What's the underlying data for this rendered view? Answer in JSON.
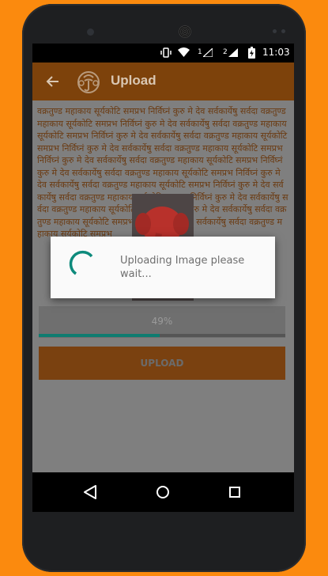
{
  "status_bar": {
    "sim1": "1",
    "sim2": "2",
    "time": "11:03"
  },
  "app_bar": {
    "title": "Upload"
  },
  "content": {
    "mantra_text": "वक्रतुण्ड महाकाय सूर्यकोटि समप्रभ निर्विघ्नं कुरु मे देव सर्वकार्येषु सर्वदा वक्रतुण्ड महाकाय सूर्यकोटि समप्रभ निर्विघ्नं कुरु मे देव सर्वकार्येषु सर्वदा वक्रतुण्ड महाकाय सूर्यकोटि समप्रभ निर्विघ्नं कुरु मे देव सर्वकार्येषु सर्वदा वक्रतुण्ड महाकाय सूर्यकोटि समप्रभ निर्विघ्नं कुरु मे देव सर्वकार्येषु सर्वदा वक्रतुण्ड महाकाय सूर्यकोटि समप्रभ निर्विघ्नं कुरु मे देव सर्वकार्येषु सर्वदा वक्रतुण्ड महाकाय सूर्यकोटि समप्रभ निर्विघ्नं कुरु मे देव सर्वकार्येषु सर्वदा वक्रतुण्ड महाकाय सूर्यकोटि समप्रभ निर्विघ्नं कुरु मे देव सर्वकार्येषु सर्वदा वक्रतुण्ड महाकाय सूर्यकोटि समप्रभ निर्विघ्नं कुरु मे देव सर्वकार्येषु सर्वदा वक्रतुण्ड महाकाय सूर्यकोटि समप्रभ निर्विघ्नं कुरु मे देव सर्वकार्येषु सर्वदा वक्रतुण्ड महाकाय सूर्यकोटि समप्रभ निर्विघ्नं कुरु मे देव सर्वकार्येषु सर्वदा वक्रतुण्ड महाकाय सूर्यकोटि समप्रभ निर्विघ्नं कुरु मे देव सर्वकार्येषु सर्वदा वक्रतुण्ड महाकाय सूर्यकोटि समप्रभ",
    "progress_percent": 49,
    "progress_label": "49%",
    "upload_button_label": "UPLOAD"
  },
  "dialog": {
    "message": "Uploading Image please wait..."
  },
  "colors": {
    "background": "#fb8a0e",
    "app_bar": "#7d420b",
    "accent": "#0e8a7c",
    "text_brown": "#6b3b12"
  },
  "icons": {
    "back": "arrow-back-icon",
    "logo": "ganesha-logo-icon",
    "nav_back": "triangle-back-icon",
    "nav_home": "circle-home-icon",
    "nav_recents": "square-recents-icon"
  }
}
